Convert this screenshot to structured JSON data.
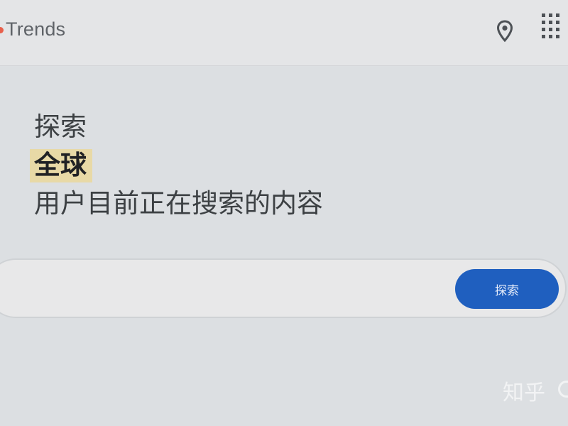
{
  "header": {
    "logo_text": "Trends",
    "location_icon": "location-pin-icon",
    "apps_icon": "apps-grid-icon"
  },
  "hero": {
    "line1": "探索",
    "line2": "全球",
    "line3": "用户目前正在搜索的内容"
  },
  "search": {
    "value": "",
    "placeholder": "",
    "button_label": "探索"
  },
  "watermark": {
    "text": "知乎"
  },
  "colors": {
    "accent_button": "#1f5fbf",
    "highlight": "#e8d9a6",
    "logo_dot": "#e8604c"
  }
}
